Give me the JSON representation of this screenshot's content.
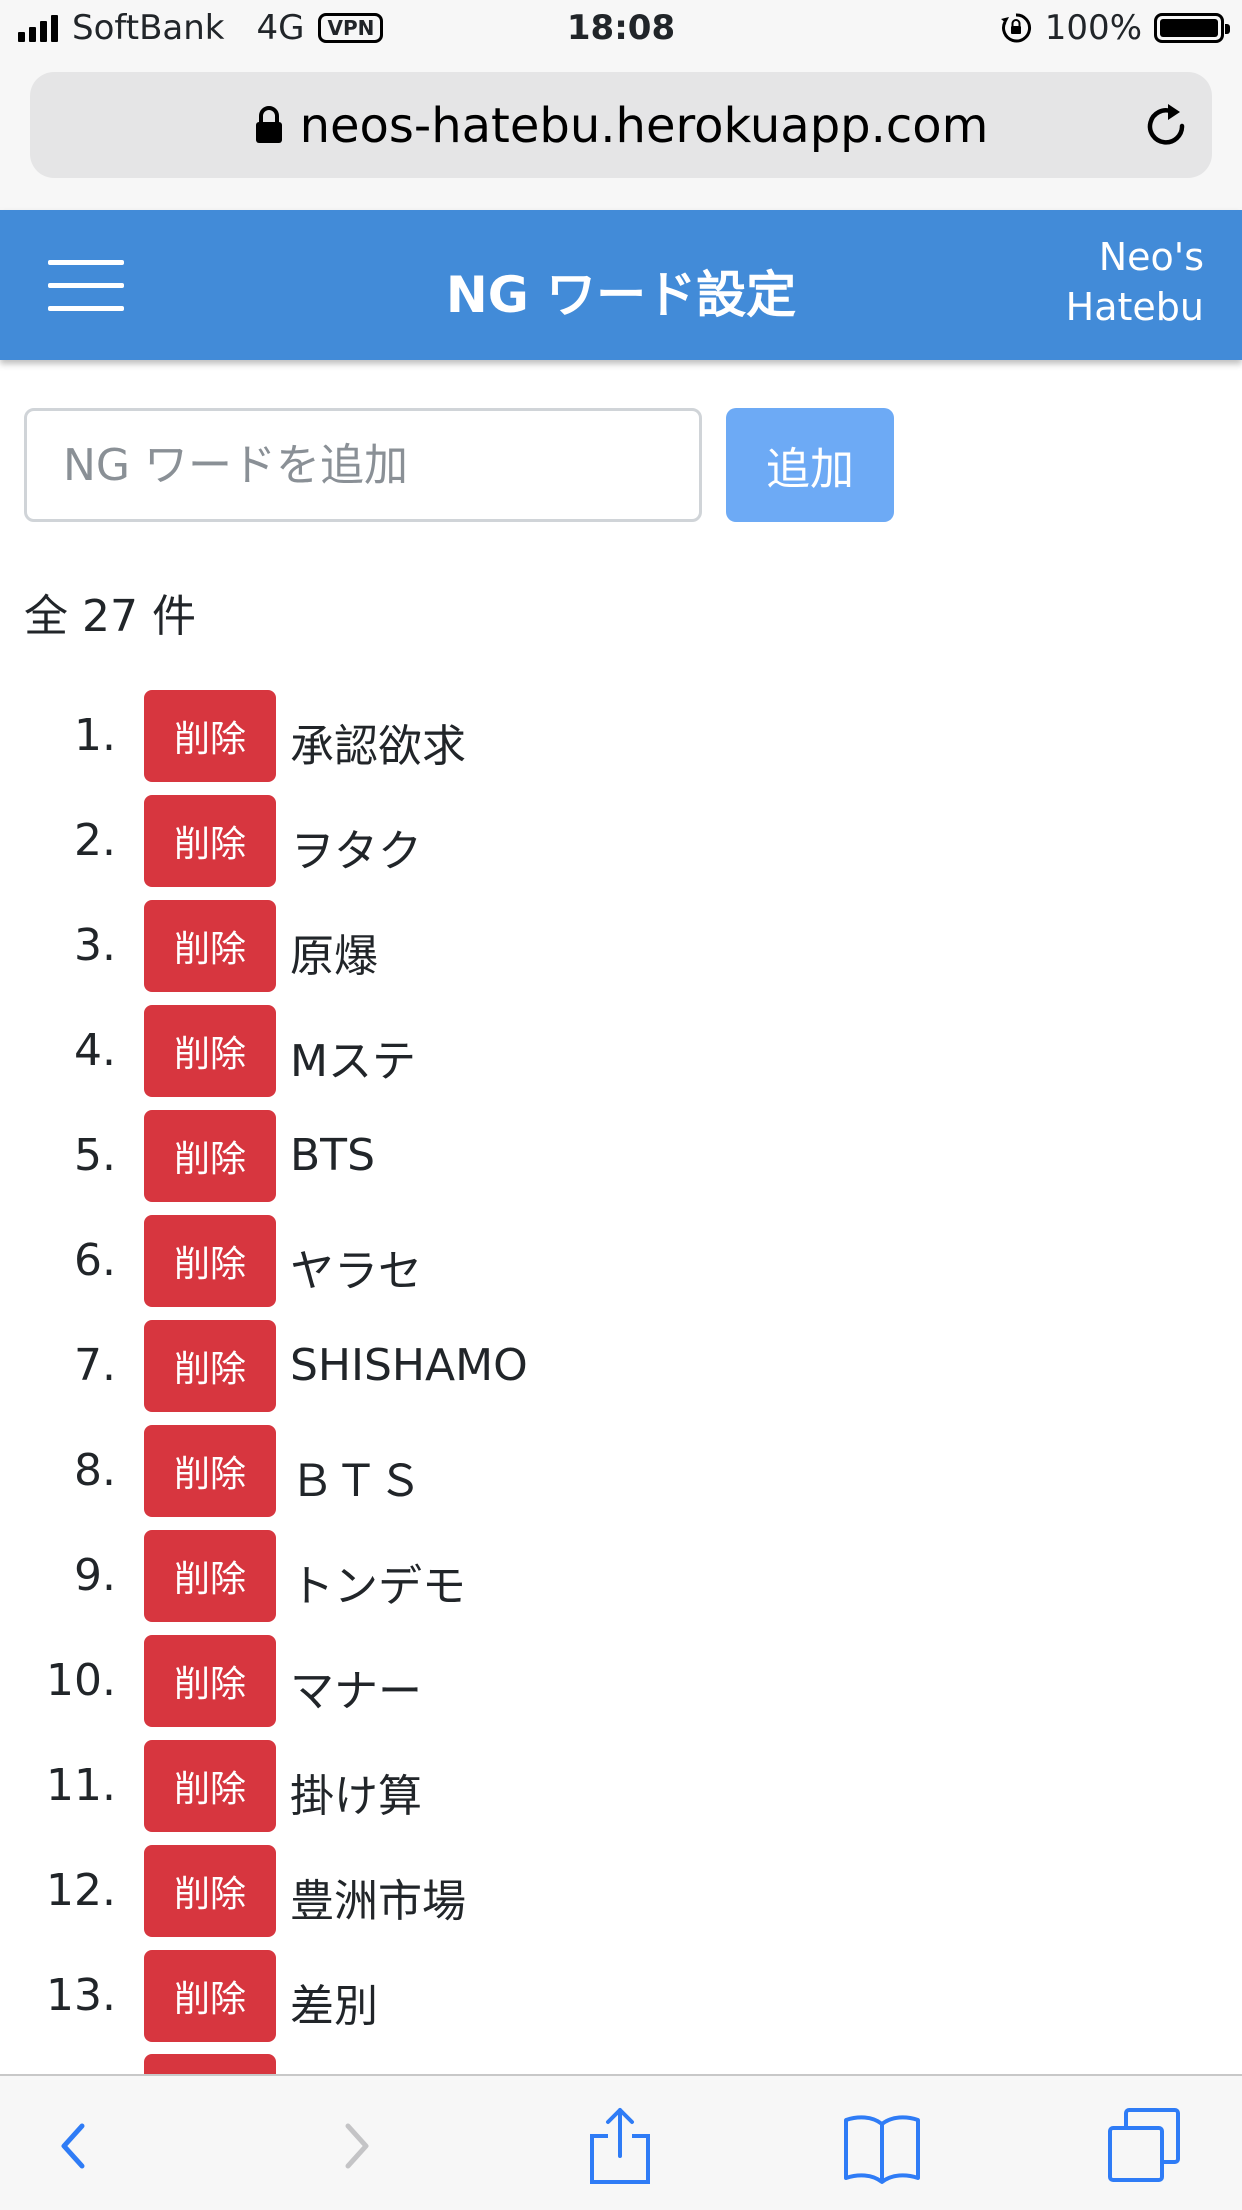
{
  "status_bar": {
    "carrier": "SoftBank",
    "network": "4G",
    "vpn": "VPN",
    "time": "18:08",
    "battery": "100%"
  },
  "browser": {
    "url": "neos-hatebu.herokuapp.com"
  },
  "navbar": {
    "title": "NG ワード設定",
    "brand_line1": "Neo's",
    "brand_line2": "Hatebu"
  },
  "form": {
    "placeholder": "NG ワードを追加",
    "add_label": "追加"
  },
  "count_text": "全 27 件",
  "delete_label": "削除",
  "ng_words": [
    {
      "num": "1.",
      "word": "承認欲求"
    },
    {
      "num": "2.",
      "word": "ヲタク"
    },
    {
      "num": "3.",
      "word": "原爆"
    },
    {
      "num": "4.",
      "word": "Mステ"
    },
    {
      "num": "5.",
      "word": "BTS"
    },
    {
      "num": "6.",
      "word": "ヤラセ"
    },
    {
      "num": "7.",
      "word": "SHISHAMO"
    },
    {
      "num": "8.",
      "word": "ＢＴＳ"
    },
    {
      "num": "9.",
      "word": "トンデモ"
    },
    {
      "num": "10.",
      "word": "マナー"
    },
    {
      "num": "11.",
      "word": "掛け算"
    },
    {
      "num": "12.",
      "word": "豊洲市場"
    },
    {
      "num": "13.",
      "word": "差別"
    }
  ],
  "colors": {
    "navbar": "#428bd8",
    "add_button": "#6daaf5",
    "delete_button": "#d7363f",
    "ios_blue": "#2f7cf6"
  }
}
